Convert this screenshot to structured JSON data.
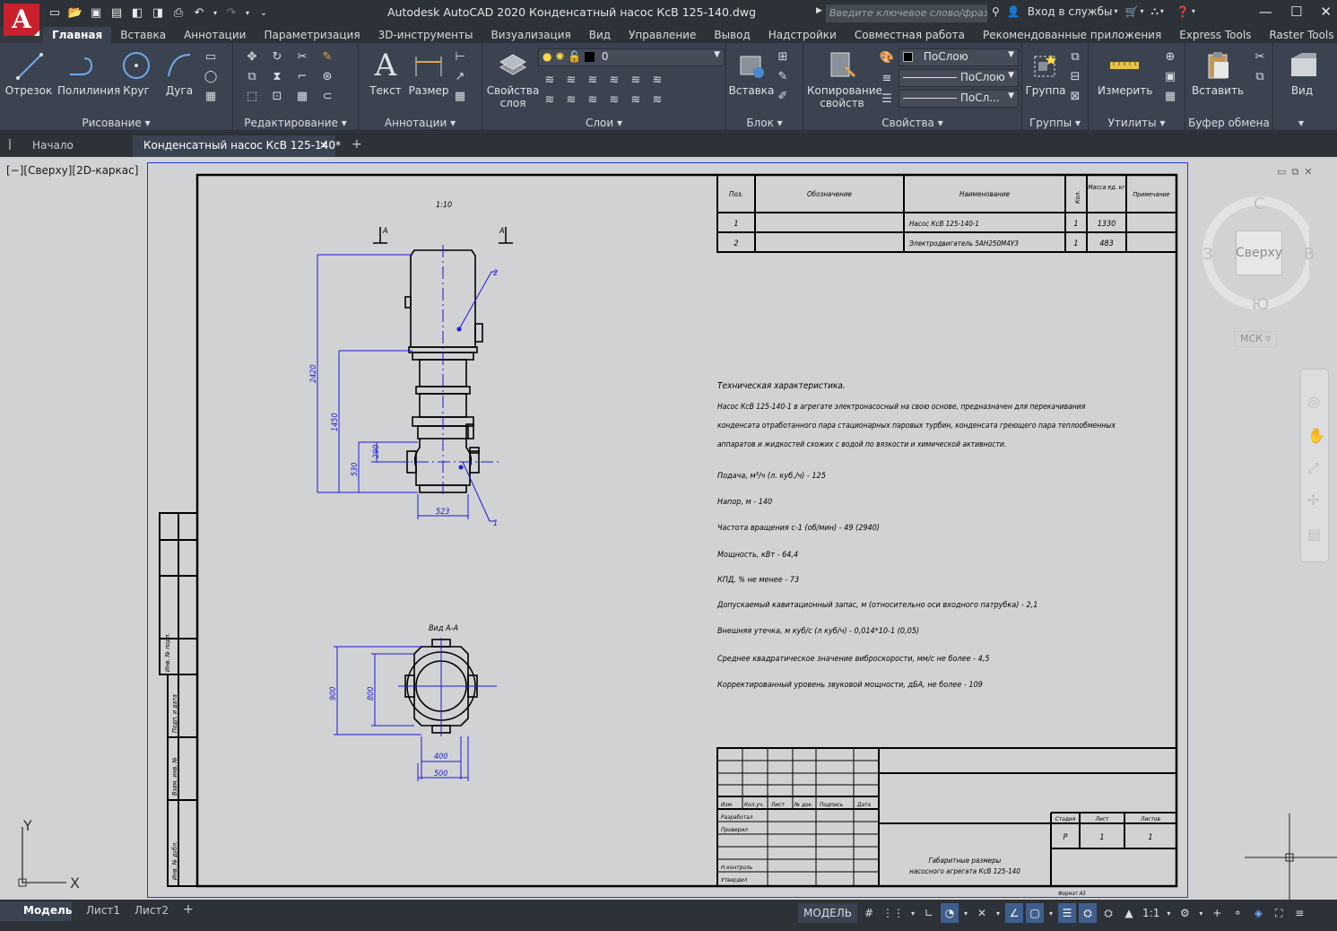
{
  "app": {
    "logo_letter": "A",
    "title": "Autodesk AutoCAD 2020    Конденсатный насос КсВ 125-140.dwg",
    "search_placeholder": "Введите ключевое слово/фразу",
    "signin": "Вход в службы"
  },
  "ribbon_tabs": [
    "Главная",
    "Вставка",
    "Аннотации",
    "Параметризация",
    "3D-инструменты",
    "Визуализация",
    "Вид",
    "Управление",
    "Вывод",
    "Надстройки",
    "Совместная работа",
    "Рекомендованные приложения",
    "Express Tools",
    "Raster Tools"
  ],
  "ribbon": {
    "draw": {
      "title": "Рисование",
      "tools": [
        "Отрезок",
        "Полилиния",
        "Круг",
        "Дуга"
      ]
    },
    "modify": {
      "title": "Редактирование"
    },
    "annot": {
      "title": "Аннотации",
      "tools": [
        "Текст",
        "Размер"
      ]
    },
    "layers": {
      "title": "Слои",
      "layer_props_1": "Свойства",
      "layer_props_2": "слоя",
      "current_layer": "0"
    },
    "block": {
      "title": "Блок",
      "insert": "Вставка"
    },
    "props": {
      "title": "Свойства",
      "match_1": "Копирование",
      "match_2": "свойств",
      "color": "ПоСлою",
      "linetype": "ПоСлою",
      "lineweight": "ПоСл..."
    },
    "groups": {
      "title": "Группы",
      "group": "Группа"
    },
    "utils": {
      "title": "Утилиты",
      "measure": "Измерить"
    },
    "clipboard": {
      "title": "Буфер обмена",
      "paste": "Вставить"
    },
    "view": {
      "title": "Вид"
    }
  },
  "doc_tabs": {
    "start": "Начало",
    "active": "Конденсатный насос КсВ 125-140*"
  },
  "viewport": {
    "label": "[−][Сверху][2D-каркас]",
    "cube": {
      "top": "Сверху",
      "n": "С",
      "s": "Ю",
      "w": "З",
      "e": "В",
      "ucs": "МСК"
    },
    "ucs_x": "X",
    "ucs_y": "Y"
  },
  "drawing": {
    "scale_note": "1:10",
    "section_mark": "А",
    "view_title": "Вид А-А",
    "dims": {
      "h_total": "2420",
      "h_pump": "1450",
      "h_nozzle": "530",
      "h_small": "290",
      "w_base": "523",
      "w_bottom_1": "400",
      "w_bottom_2": "500",
      "v_left_1": "900",
      "v_left_2": "800"
    },
    "leaders": [
      "1",
      "2"
    ],
    "spec": {
      "headers": [
        "Поз.",
        "Обозначение",
        "Наименование",
        "Кол.",
        "Масса ед. кг",
        "Примечание"
      ],
      "rows": [
        [
          "1",
          "",
          "Насос КсВ 125-140-1",
          "1",
          "1330",
          ""
        ],
        [
          "2",
          "",
          "Электродвигатель 5АН250М4У3",
          "1",
          "483",
          ""
        ]
      ]
    },
    "tech_title": "Техническая характеристика.",
    "tech_desc": [
      "Насос КсВ 125-140-1 в агрегате электронасосный на свою основе, предназначен для перекачивания",
      "конденсата отработанного пара стационарных паровых турбин, конденсата греющего пара теплообменных",
      "аппаратов и жидкостей схожих с водой по вязкости и химической активности."
    ],
    "tech_items": [
      "Подача, м³/ч (л. куб./ч) - 125",
      "Напор, м - 140",
      "Частота вращения с-1 (об/мин) - 49 (2940)",
      "Мощность, кВт - 64,4",
      "КПД, % не менее - 73",
      "Допускаемый кавитационный запас, м (относительно оси входного патрубка) - 2,1",
      "Внешняя утечка, м куб/с (л куб/ч) - 0,014*10-1 (0,05)",
      "Среднее квадратическое значение виброскорости, мм/с не более - 4,5",
      "Корректированный уровень звуковой мощности, дБА, не более - 109"
    ],
    "stamp": {
      "cols": [
        "Изм.",
        "Кол.уч.",
        "Лист",
        "№ док.",
        "Подпись",
        "Дата"
      ],
      "rows": [
        "Разработал",
        "Проверил",
        "",
        "Н.контроль",
        "Утвердил"
      ],
      "stage_h": "Стадия",
      "sheet_h": "Лист",
      "sheets_h": "Листов",
      "stage": "Р",
      "sheet": "1",
      "sheets": "1",
      "name_1": "Габаритные размеры",
      "name_2": "насосного агрегата КсВ 125-140",
      "format": "Формат А3"
    },
    "side_stamp": [
      "Инв. № подл.",
      "Подп. и дата",
      "Взам. инв. №",
      "Инв. № дубл.",
      "Подп. и дата"
    ]
  },
  "status": {
    "layouts": [
      "Модель",
      "Лист1",
      "Лист2"
    ],
    "mode": "МОДЕЛЬ",
    "scale": "1:1"
  }
}
